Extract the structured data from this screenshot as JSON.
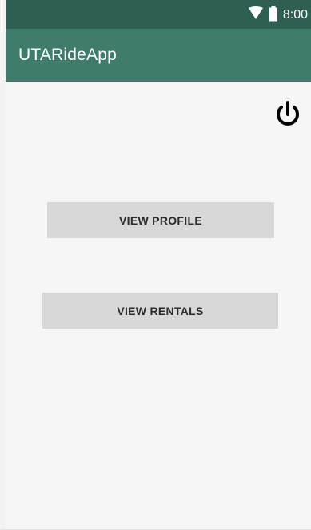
{
  "status_bar": {
    "time": "8:00",
    "icons": [
      "wifi-icon",
      "battery-icon"
    ]
  },
  "app_bar": {
    "title": "UTARideApp"
  },
  "main": {
    "logout_icon": "power-icon",
    "buttons": [
      {
        "label": "VIEW PROFILE"
      },
      {
        "label": "VIEW RENTALS"
      }
    ]
  },
  "colors": {
    "status_bar": "#2f5f52",
    "app_bar": "#3f7c6b",
    "background": "#f6f6f6",
    "button": "#d8d8d8",
    "button_text": "#2a2a2a"
  }
}
